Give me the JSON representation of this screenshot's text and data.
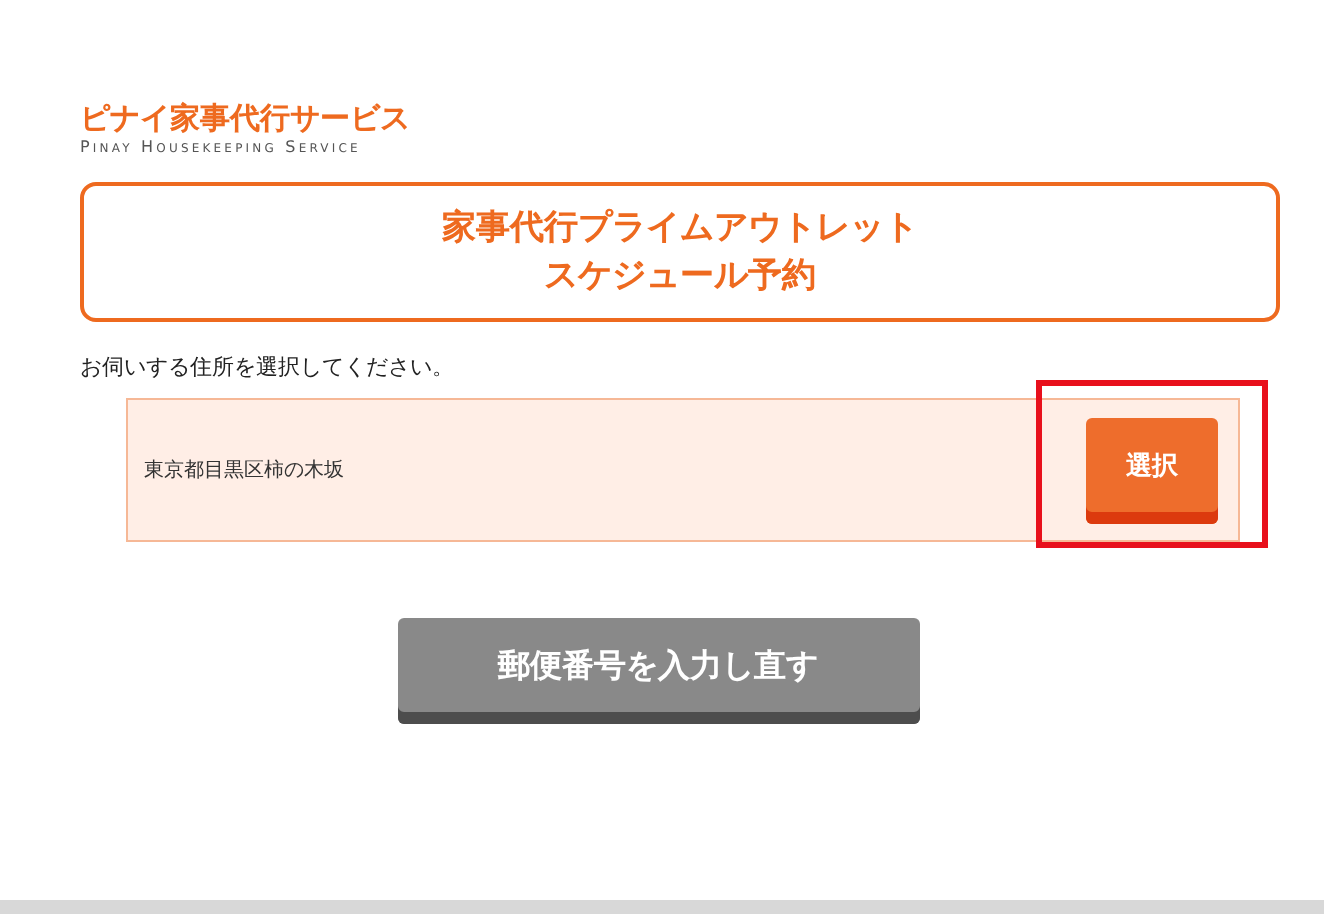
{
  "logo": {
    "name": "ピナイ家事代行サービス",
    "tagline": "Pinay Housekeeping Service"
  },
  "heading": {
    "lines": [
      "家事代行プライムアウトレット",
      "スケジュール予約"
    ]
  },
  "instruction": "お伺いする住所を選択してください。",
  "addresses": [
    {
      "text": "東京都目黒区柿の木坂",
      "button": "選択",
      "highlighted": true
    }
  ],
  "reenter_button": "郵便番号を入力し直す"
}
